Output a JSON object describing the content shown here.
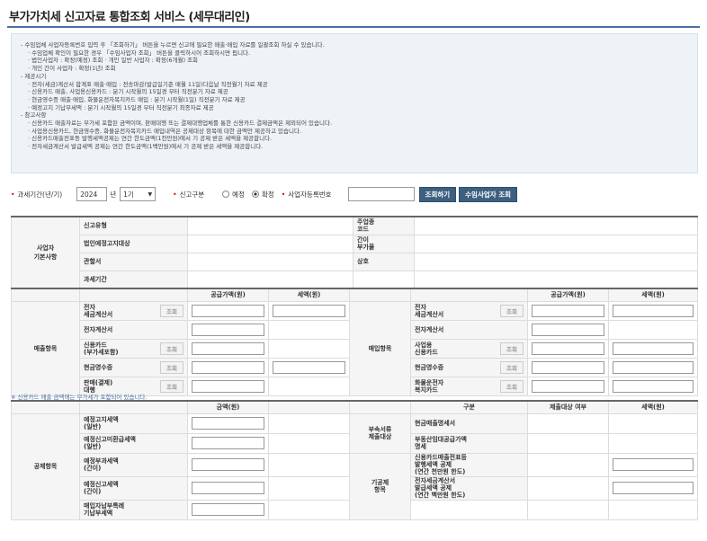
{
  "title": "부가가치세 신고자료 통합조회 서비스 (세무대리인)",
  "guide": [
    {
      "lvl": 1,
      "text": "- 수임업체 사업자등록번호 입력 후 「조회하기」 버튼을 누르면 신고에 필요한 매출·매입 자료를 일괄조회 하실 수 있습니다."
    },
    {
      "lvl": 2,
      "text": "· 수임업체 확인이 필요한 경우 「수임사업자 조회」 버튼을 클릭하시어 조회하시면 됩니다."
    },
    {
      "lvl": 2,
      "text": "· 법인사업자 : 확정(예정) 조회 · 개인 일반 사업자 : 확정(6개월) 조회"
    },
    {
      "lvl": 2,
      "text": "· 개인 간이 사업자 : 확정(1년) 조회"
    },
    {
      "lvl": 1,
      "text": "- 제공시기"
    },
    {
      "lvl": 2,
      "text": "· 전자(세금)계산서 합계표 매출·매입 : 전송마감(발급일기준 매월 11일)다음날 직전월기 자료 제공"
    },
    {
      "lvl": 2,
      "text": "· 신용카드 매출, 사업용신용카드 : 분기 시작월의 15일경 부터 직전분기 자료 제공"
    },
    {
      "lvl": 2,
      "text": "· 현금영수증 매출·매입, 화물운전자복지카드 매입 : 분기 시작월(1일) 직전분기 자료 제공"
    },
    {
      "lvl": 2,
      "text": "· 예정고지 기납부세액 : 분기 시작월의 15일경 부터 직전분기 최종자료 제공"
    },
    {
      "lvl": 1,
      "text": "- 참고사항"
    },
    {
      "lvl": 2,
      "text": "· 신용카드 매출자료는 부가세 포함된 금액이며, 판매대행 또는 결제대행업체를 통한 신용카드 결제금액은 제외되어 있습니다."
    },
    {
      "lvl": 2,
      "text": "· 사업용신용카드, 현금영수증, 화물운전자복지카드 매입내역은 공제대상 항목에 대한 금액만 제공하고 있습니다."
    },
    {
      "lvl": 2,
      "text": "· 신용카드매출전표등 발행세액공제는 연간 한도금액(1천만원)에서 기 공제 받은 세액을 제공합니다."
    },
    {
      "lvl": 2,
      "text": "· 전자세금계산서 발급세액 공제는 연간 한도금액(1백만원)에서 기 공제 받은 세액을 제공합니다."
    }
  ],
  "search": {
    "period_label": "과세기간(년/기)",
    "year": "2024",
    "year_unit": "년",
    "term": "1기",
    "report_type_label": "신고구분",
    "opt_prelim": "예정",
    "opt_final": "확정",
    "bizno_label": "사업자등록번호",
    "btn_search": "조회하기",
    "btn_client": "수임사업자 조회"
  },
  "basic": {
    "section": "사업자\n기본사항",
    "report_type": "신고유형",
    "main_biz": "주업종\n코드",
    "corp_prelim": "법인예정고지대상",
    "simple_tax": "간이\n부가율",
    "jurisdiction": "관할서",
    "trade_name": "상호",
    "period": "과세기간"
  },
  "sales_purchase": {
    "supply_header": "공급가액(원)",
    "tax_header": "세액(원)",
    "sales_section": "매출항목",
    "purchase_section": "매입항목",
    "view_btn": "조회",
    "sales_rows": [
      {
        "label": "전자\n세금계산서",
        "btn": true,
        "supply": true,
        "tax": true
      },
      {
        "label": "전자계산서",
        "btn": false,
        "supply": true,
        "tax": false
      },
      {
        "label": "신용카드\n(부가세포함)",
        "btn": true,
        "supply": true,
        "tax": false
      },
      {
        "label": "현금영수증",
        "btn": true,
        "supply": true,
        "tax": true
      },
      {
        "label": "판매(결제)\n대행",
        "btn": true,
        "supply": true,
        "tax": false
      }
    ],
    "purchase_rows": [
      {
        "label": "전자\n세금계산서",
        "btn": true,
        "supply": true,
        "tax": true
      },
      {
        "label": "전자계산서",
        "btn": false,
        "supply": true,
        "tax": false
      },
      {
        "label": "사업용\n신용카드",
        "btn": true,
        "supply": true,
        "tax": true
      },
      {
        "label": "현금영수증",
        "btn": true,
        "supply": true,
        "tax": true
      },
      {
        "label": "화물운전자\n복지카드",
        "btn": true,
        "supply": true,
        "tax": true
      }
    ]
  },
  "note": "※ 신용카드 매출 금액에는 부가세가 포함되어 있습니다.",
  "deduction": {
    "section": "공제항목",
    "amount_header": "금액(원)",
    "type_header": "구분",
    "eligible_header": "제출대상 여부",
    "tax_header": "세액(원)",
    "left_rows": [
      "예정고지세액\n(일반)",
      "예정신고미환급세액\n(일반)",
      "예정부과세액\n(간이)",
      "예정신고세액\n(간이)",
      "매입자납부특례\n기납부세액"
    ],
    "attach_section": "부속서류\n제출대상",
    "attach_rows": [
      "현금매출명세서",
      "부동산임대공급가액\n명세"
    ],
    "other_section": "기공제\n항목",
    "other_rows": [
      "신용카드매출전표등\n발행세액 공제\n(연간 천만원 한도)",
      "전자세금계산서\n발급세액 공제\n(연간 백만원 한도)"
    ]
  }
}
